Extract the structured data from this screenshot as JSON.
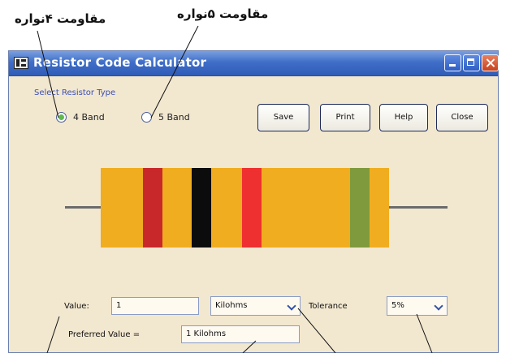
{
  "callouts": {
    "four_band": "مقاومت ۴نواره",
    "five_band": "مقاومت ۵نواره"
  },
  "window": {
    "title": "Resistor Code Calculator",
    "icon": "calculator-app-icon",
    "controls": [
      "minimize",
      "maximize",
      "close"
    ]
  },
  "resistor_type": {
    "label": "Select Resistor Type",
    "options": [
      "4 Band",
      "5 Band"
    ],
    "selected": "4 Band"
  },
  "buttons": {
    "save": "Save",
    "print": "Print",
    "help": "Help",
    "close": "Close"
  },
  "resistor": {
    "body_color": "#f0ad1f",
    "bands": [
      "#c8282a",
      "#0c0c0c",
      "#ee3030",
      "#7f9a3c"
    ]
  },
  "form": {
    "value_label": "Value:",
    "value": "1",
    "unit": "Kilohms",
    "tolerance_label": "Tolerance",
    "tolerance": "5%",
    "preferred_label": "Preferred Value =",
    "preferred_value": "1 Kilohms"
  }
}
